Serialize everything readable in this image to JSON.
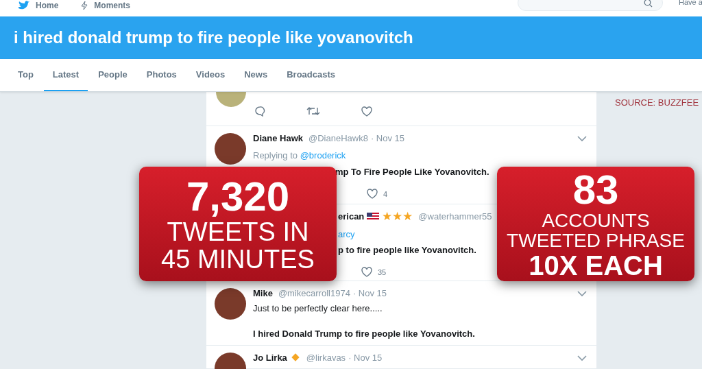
{
  "nav": {
    "items": [
      "Home",
      "Moments"
    ],
    "right_text": "Have a"
  },
  "search_title": "i hired donald trump to fire people like yovanovitch",
  "tabs": [
    {
      "label": "Top",
      "selected": false
    },
    {
      "label": "Latest",
      "selected": true
    },
    {
      "label": "People",
      "selected": false
    },
    {
      "label": "Photos",
      "selected": false
    },
    {
      "label": "Videos",
      "selected": false
    },
    {
      "label": "News",
      "selected": false
    },
    {
      "label": "Broadcasts",
      "selected": false
    }
  ],
  "source": "SOURCE: BUZZFEE",
  "tweets": [
    {
      "kind": "actions_only"
    },
    {
      "kind": "full",
      "name": "Diane Hawk",
      "handle": "@DianeHawk8",
      "date": "· Nov 15",
      "replying": "Replying to",
      "reply_to": "@broderick",
      "text": "mp To Fire People Like Yovanovitch.",
      "likes": "4"
    },
    {
      "kind": "covered",
      "name": "erican",
      "badge": "★★★",
      "handle": "@waterhammer55",
      "reply_to": "arcy",
      "text": "p to fire people like Yovanovitch.",
      "likes": "35"
    },
    {
      "kind": "full",
      "name": "Mike",
      "handle": "@mikecarroll1974",
      "date": "· Nov 15",
      "lines": [
        "Just to be perfectly clear here.....",
        "I hired Donald Trump to fire people like Yovanovitch."
      ]
    },
    {
      "kind": "full",
      "name": "Jo Lirka",
      "handle": "@lirkavas",
      "date": "· Nov 15",
      "verified_mark": true
    }
  ],
  "overlays": [
    {
      "big": "7,320",
      "lines": [
        "TWEETS IN",
        "45 MINUTES"
      ]
    },
    {
      "big": "83",
      "lines": [
        "ACCOUNTS",
        "TWEETED PHRASE"
      ],
      "bold_line": "10X EACH"
    }
  ]
}
